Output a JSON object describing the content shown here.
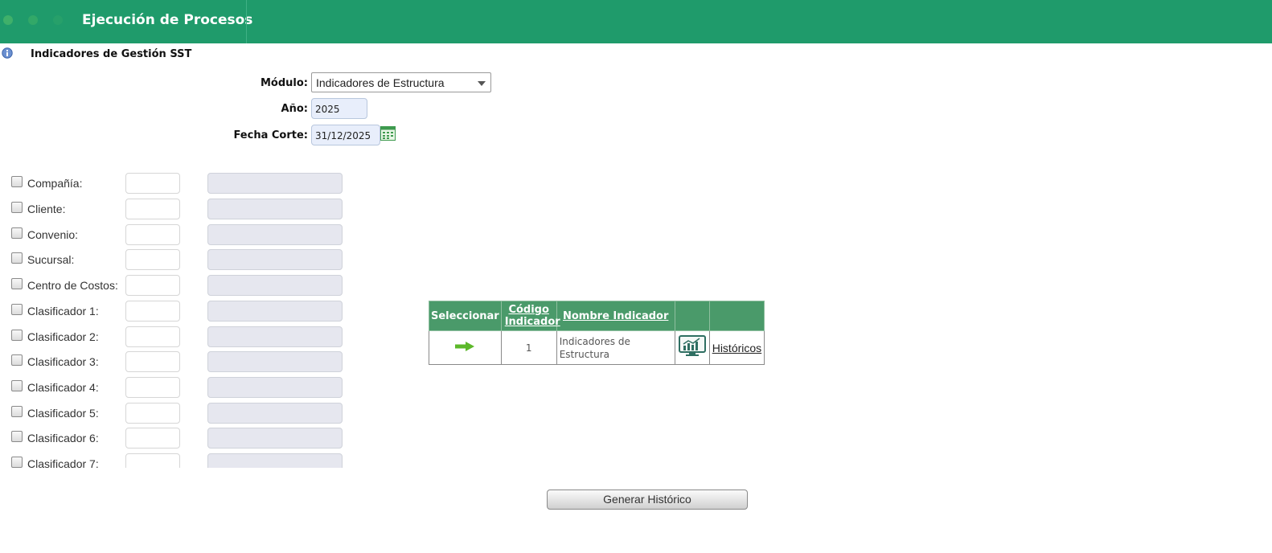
{
  "header": {
    "title": "Ejecución de Procesos",
    "accent": "#1f9b6b"
  },
  "section": {
    "title": "Indicadores de Gestión SST"
  },
  "form": {
    "modulo_label": "Módulo:",
    "modulo_value": "Indicadores de Estructura",
    "anio_label": "Año:",
    "anio_value": "2025",
    "fecha_label": "Fecha Corte:",
    "fecha_value": "31/12/2025"
  },
  "filters": [
    {
      "label": "Compañía:"
    },
    {
      "label": "Cliente:"
    },
    {
      "label": "Convenio:"
    },
    {
      "label": "Sucursal:"
    },
    {
      "label": "Centro de Costos:"
    },
    {
      "label": "Clasificador 1:"
    },
    {
      "label": "Clasificador 2:"
    },
    {
      "label": "Clasificador 3:"
    },
    {
      "label": "Clasificador 4:"
    },
    {
      "label": "Clasificador 5:"
    },
    {
      "label": "Clasificador 6:"
    },
    {
      "label": "Clasificador 7:"
    }
  ],
  "grid": {
    "headers": [
      "Seleccionar",
      "Código Indicador",
      "Nombre Indicador",
      "",
      ""
    ],
    "rows": [
      {
        "codigo": "1",
        "nombre": "Indicadores de Estructura",
        "link": "Históricos",
        "select_icon": "arrow-right-icon",
        "chart_icon": "chart-monitor-icon"
      }
    ]
  },
  "actions": {
    "generar": "Generar Histórico"
  }
}
